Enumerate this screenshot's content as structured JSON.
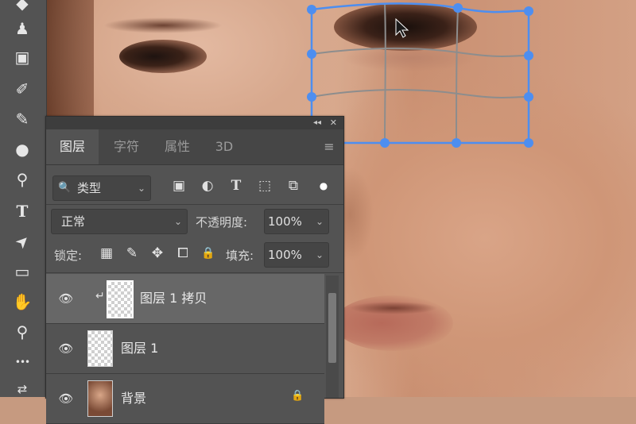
{
  "app": "Photoshop",
  "colors": {
    "accent": "#4d8ef0",
    "panel": "#535353",
    "toolbar": "#535353",
    "selected_row": "#676767"
  },
  "tools": [
    {
      "name": "eraser-tool-icon",
      "glyph": "◆"
    },
    {
      "name": "stamp-tool-icon",
      "glyph": "♟"
    },
    {
      "name": "gradient-tool-icon",
      "glyph": "▣"
    },
    {
      "name": "eraser-icon",
      "glyph": "✐"
    },
    {
      "name": "pen-tool-icon",
      "glyph": "✎"
    },
    {
      "name": "blur-tool-icon",
      "glyph": "●"
    },
    {
      "name": "dodge-tool-icon",
      "glyph": "⚲"
    },
    {
      "name": "type-tool-icon",
      "glyph": "T"
    },
    {
      "name": "path-select-tool-icon",
      "glyph": "➤"
    },
    {
      "name": "rectangle-tool-icon",
      "glyph": "▭"
    },
    {
      "name": "hand-tool-icon",
      "glyph": "✋"
    },
    {
      "name": "zoom-tool-icon",
      "glyph": "⚲"
    },
    {
      "name": "more-tools-icon",
      "glyph": "•••"
    },
    {
      "name": "color-swap-icon",
      "glyph": "⇄"
    }
  ],
  "panel": {
    "collapse_glyph": "◂◂",
    "close_glyph": "✕",
    "menu_glyph": "≡",
    "tabs": [
      {
        "label": "图层",
        "active": true
      },
      {
        "label": "字符",
        "active": false
      },
      {
        "label": "属性",
        "active": false
      },
      {
        "label": "3D",
        "active": false
      }
    ],
    "filter": {
      "search_glyph": "🔍",
      "value": "类型",
      "arrow": "⌄"
    },
    "filter_icons": [
      {
        "name": "pixel-filter-icon",
        "glyph": "▣"
      },
      {
        "name": "adjustment-filter-icon",
        "glyph": "◐"
      },
      {
        "name": "type-filter-icon",
        "glyph": "T"
      },
      {
        "name": "shape-filter-icon",
        "glyph": "⬚"
      },
      {
        "name": "smart-object-filter-icon",
        "glyph": "⧉"
      },
      {
        "name": "filter-toggle-icon",
        "glyph": "●"
      }
    ],
    "blend_mode": "正常",
    "opacity_label": "不透明度:",
    "opacity_value": "100%",
    "lock_label": "锁定:",
    "lock_icons": [
      {
        "name": "lock-transparent-icon",
        "glyph": "▦"
      },
      {
        "name": "lock-image-icon",
        "glyph": "✎"
      },
      {
        "name": "lock-position-icon",
        "glyph": "✥"
      },
      {
        "name": "lock-artboard-icon",
        "glyph": "⧠"
      },
      {
        "name": "lock-all-icon",
        "glyph": "🔒"
      }
    ],
    "fill_label": "填充:",
    "fill_value": "100%",
    "layers": [
      {
        "name": "图层 1 拷贝",
        "selected": true,
        "eye": "👁",
        "link": "↵"
      },
      {
        "name": "图层 1",
        "selected": false,
        "eye": "👁"
      },
      {
        "name": "背景",
        "selected": false,
        "eye": "👁",
        "lock": "🔒"
      }
    ]
  }
}
